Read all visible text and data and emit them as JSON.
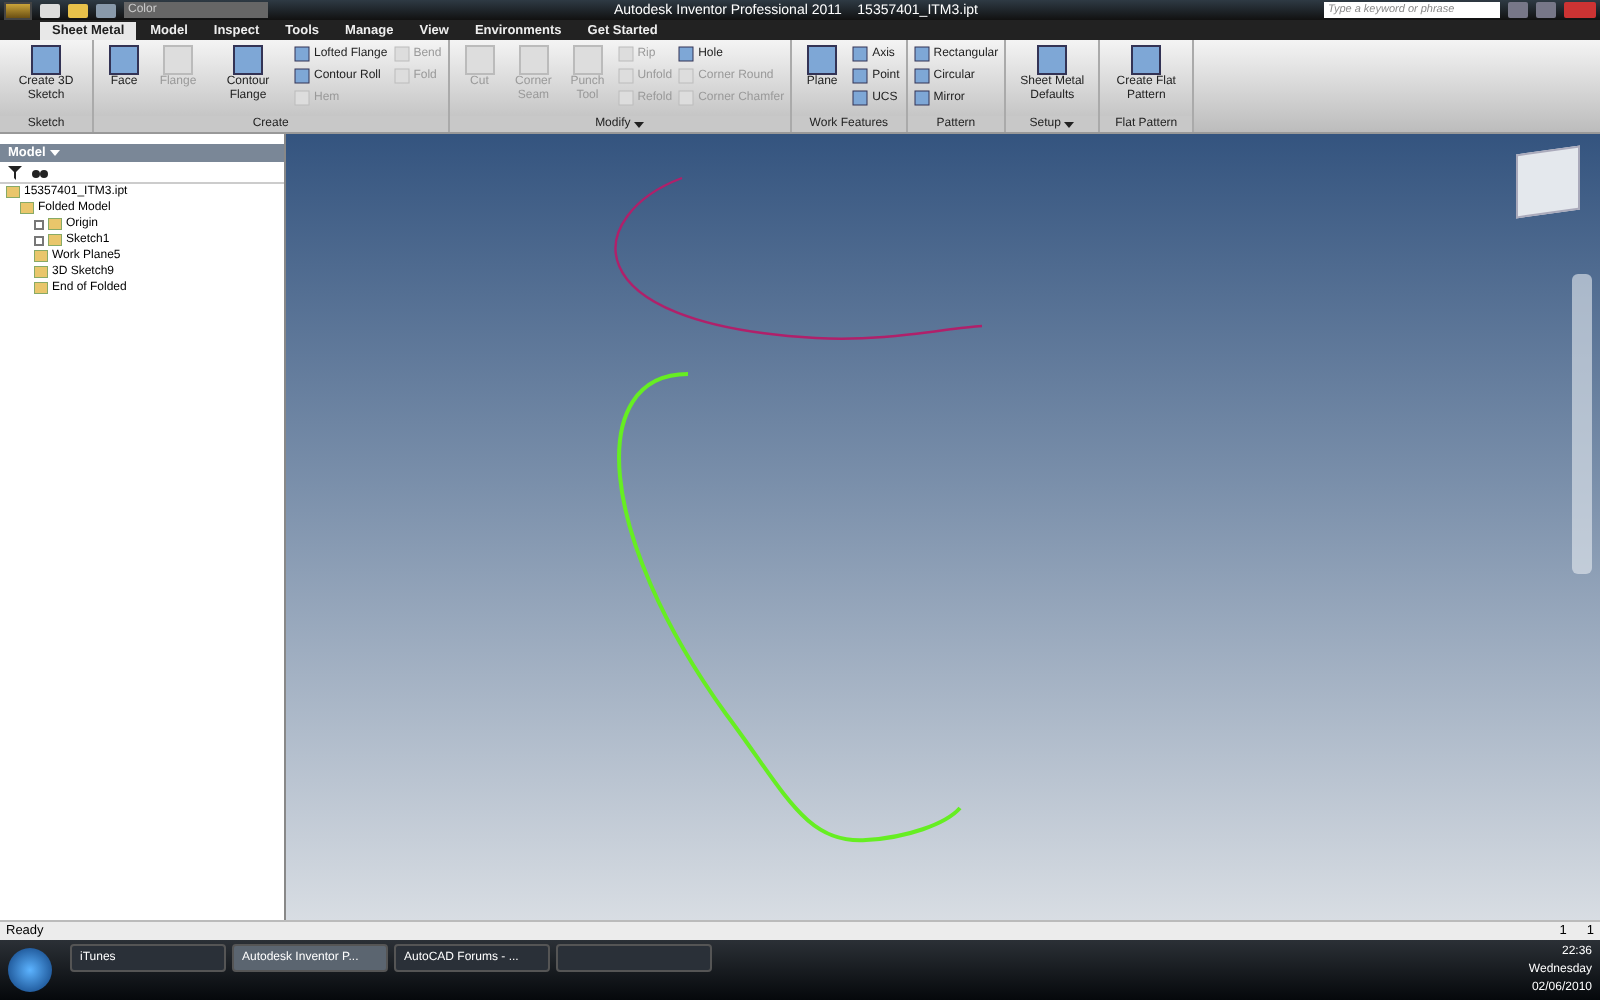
{
  "title_bar": {
    "title": "Autodesk Inventor Professional 2011    15357401_ITM3.ipt",
    "color_dropdown": "Color",
    "search_placeholder": "Type a keyword or phrase"
  },
  "tabs": [
    {
      "label": "Sheet Metal",
      "selected": true
    },
    {
      "label": "Model",
      "selected": false
    },
    {
      "label": "Inspect",
      "selected": false
    },
    {
      "label": "Tools",
      "selected": false
    },
    {
      "label": "Manage",
      "selected": false
    },
    {
      "label": "View",
      "selected": false
    },
    {
      "label": "Environments",
      "selected": false
    },
    {
      "label": "Get Started",
      "selected": false
    }
  ],
  "ribbon": [
    {
      "title": "Sketch",
      "menu": false,
      "columns": [
        [
          {
            "label": "Create 3D Sketch",
            "kind": "large",
            "disabled": false
          }
        ]
      ]
    },
    {
      "title": "Create",
      "menu": false,
      "columns": [
        [
          {
            "label": "Face",
            "kind": "large",
            "disabled": false
          }
        ],
        [
          {
            "label": "Flange",
            "kind": "large",
            "disabled": true
          }
        ],
        [
          {
            "label": "Contour Flange",
            "kind": "large",
            "disabled": false
          }
        ],
        [
          {
            "label": "Lofted Flange",
            "kind": "small",
            "disabled": false
          },
          {
            "label": "Contour Roll",
            "kind": "small",
            "disabled": false
          },
          {
            "label": "Hem",
            "kind": "small",
            "disabled": true
          }
        ],
        [
          {
            "label": "Bend",
            "kind": "small",
            "disabled": true
          },
          {
            "label": "Fold",
            "kind": "small",
            "disabled": true
          }
        ]
      ]
    },
    {
      "title": "Modify",
      "menu": true,
      "columns": [
        [
          {
            "label": "Cut",
            "kind": "large",
            "disabled": true
          }
        ],
        [
          {
            "label": "Corner Seam",
            "kind": "large",
            "disabled": true
          }
        ],
        [
          {
            "label": "Punch Tool",
            "kind": "large",
            "disabled": true
          }
        ],
        [
          {
            "label": "Rip",
            "kind": "small",
            "disabled": true
          },
          {
            "label": "Unfold",
            "kind": "small",
            "disabled": true
          },
          {
            "label": "Refold",
            "kind": "small",
            "disabled": true
          }
        ],
        [
          {
            "label": "Hole",
            "kind": "small",
            "disabled": false
          },
          {
            "label": "Corner Round",
            "kind": "small",
            "disabled": true
          },
          {
            "label": "Corner Chamfer",
            "kind": "small",
            "disabled": true
          }
        ]
      ]
    },
    {
      "title": "Work Features",
      "menu": false,
      "columns": [
        [
          {
            "label": "Plane",
            "kind": "large",
            "disabled": false
          }
        ],
        [
          {
            "label": "Axis",
            "kind": "small",
            "disabled": false
          },
          {
            "label": "Point",
            "kind": "small",
            "disabled": false
          },
          {
            "label": "UCS",
            "kind": "small",
            "disabled": false
          }
        ]
      ]
    },
    {
      "title": "Pattern",
      "menu": false,
      "columns": [
        [
          {
            "label": "Rectangular",
            "kind": "small",
            "disabled": false
          },
          {
            "label": "Circular",
            "kind": "small",
            "disabled": false
          },
          {
            "label": "Mirror",
            "kind": "small",
            "disabled": false
          }
        ]
      ]
    },
    {
      "title": "Setup",
      "menu": true,
      "columns": [
        [
          {
            "label": "Sheet Metal Defaults",
            "kind": "large",
            "disabled": false
          }
        ]
      ]
    },
    {
      "title": "Flat Pattern",
      "menu": false,
      "columns": [
        [
          {
            "label": "Create Flat Pattern",
            "kind": "large",
            "disabled": false
          }
        ]
      ]
    }
  ],
  "browser": {
    "title": "Model",
    "tree": [
      {
        "label": "15357401_ITM3.ipt",
        "collapsed": false,
        "children": [
          {
            "label": "Folded Model",
            "collapsed": false,
            "children": [
              {
                "label": "Origin",
                "collapsed": true
              },
              {
                "label": "Sketch1",
                "collapsed": true
              },
              {
                "label": "Work Plane5",
                "collapsed": false
              },
              {
                "label": "3D Sketch9",
                "collapsed": false
              },
              {
                "label": "End of Folded",
                "collapsed": false
              }
            ]
          }
        ]
      }
    ]
  },
  "status_bar": {
    "text": "Ready",
    "counts": [
      "1",
      "1"
    ]
  },
  "taskbar": {
    "buttons": [
      {
        "label": "iTunes",
        "selected": false
      },
      {
        "label": "Autodesk Inventor P...",
        "selected": true
      },
      {
        "label": "AutoCAD Forums - ...",
        "selected": false
      },
      {
        "selected": false
      }
    ],
    "clock": {
      "time": "22:36",
      "day": "Wednesday",
      "date": "02/06/2010"
    }
  }
}
